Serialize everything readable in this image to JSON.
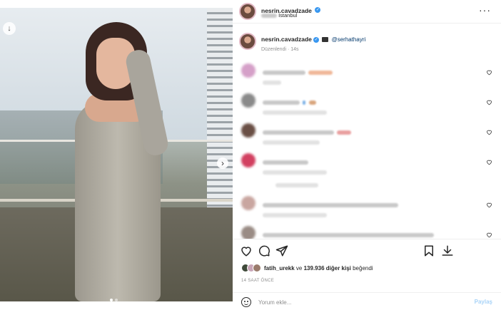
{
  "post": {
    "username": "nesrin.cavadzade",
    "location": "İstanbul",
    "more_icon": "more-dots-icon"
  },
  "caption": {
    "username": "nesrin.cavadzade",
    "mention": "@serhathayri",
    "edited": "Düzenlendi · 14s"
  },
  "comments": [
    {
      "blurred": true
    },
    {
      "blurred": true
    },
    {
      "blurred": true
    },
    {
      "blurred": true
    },
    {
      "blurred": true
    },
    {
      "blurred": true
    }
  ],
  "actions": {
    "like_icon": "heart-icon",
    "comment_icon": "comment-icon",
    "share_icon": "send-icon",
    "save_icon": "bookmark-icon",
    "download_icon": "download-icon"
  },
  "likes": {
    "user": "fatih_urekk",
    "connector": "ve",
    "others": "139.936 diğer kişi",
    "suffix": "beğendi"
  },
  "time": "14 SAAT ÖNCE",
  "comment_box": {
    "placeholder": "Yorum ekle...",
    "post_label": "Paylaş"
  },
  "colors": {
    "accent_blue": "#3897f0",
    "link_blue": "#00376b",
    "post_button_disabled": "#a8d3f8",
    "muted_text": "#8e8e8e"
  },
  "carousel": {
    "current": 1,
    "total": 2
  }
}
